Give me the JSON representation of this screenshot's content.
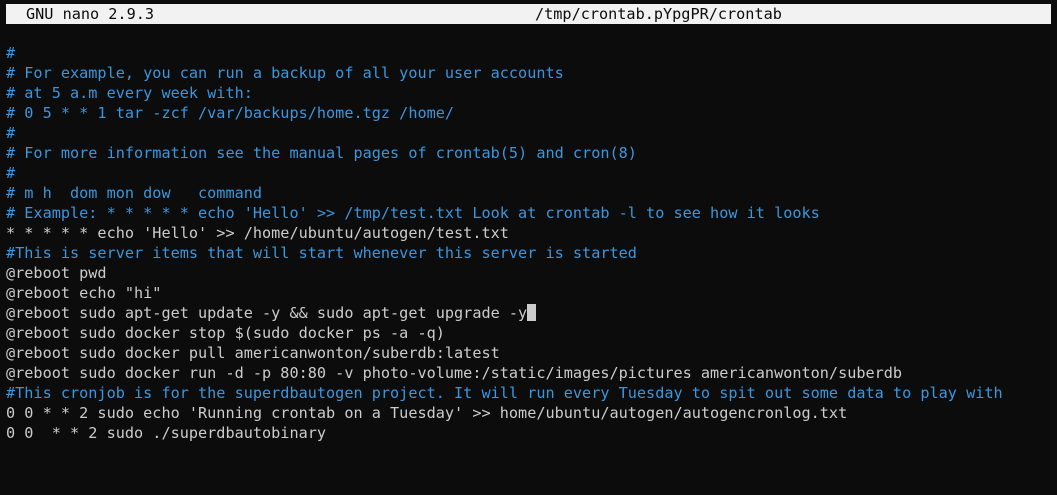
{
  "header": {
    "app": "GNU nano 2.9.3",
    "file": "/tmp/crontab.pYpgPR/crontab"
  },
  "colors": {
    "background": "#0c0c0c",
    "text": "#cccccc",
    "comment": "#3a96dd",
    "titlebar": "#f2f2f2"
  },
  "lines": [
    {
      "text": "#",
      "type": "comment"
    },
    {
      "text": "# For example, you can run a backup of all your user accounts",
      "type": "comment"
    },
    {
      "text": "# at 5 a.m every week with:",
      "type": "comment"
    },
    {
      "text": "# 0 5 * * 1 tar -zcf /var/backups/home.tgz /home/",
      "type": "comment"
    },
    {
      "text": "#",
      "type": "comment"
    },
    {
      "text": "# For more information see the manual pages of crontab(5) and cron(8)",
      "type": "comment"
    },
    {
      "text": "#",
      "type": "comment"
    },
    {
      "text": "# m h  dom mon dow   command",
      "type": "comment"
    },
    {
      "text": "# Example: * * * * * echo 'Hello' >> /tmp/test.txt Look at crontab -l to see how it looks",
      "type": "comment"
    },
    {
      "text": "* * * * * echo 'Hello' >> /home/ubuntu/autogen/test.txt",
      "type": "code"
    },
    {
      "text": "#This is server items that will start whenever this server is started",
      "type": "comment"
    },
    {
      "text": "@reboot pwd",
      "type": "code"
    },
    {
      "text": "@reboot echo \"hi\"",
      "type": "code"
    },
    {
      "text": "@reboot sudo apt-get update -y && sudo apt-get upgrade -y",
      "type": "code"
    },
    {
      "text": "@reboot sudo docker stop $(sudo docker ps -a -q)",
      "type": "code"
    },
    {
      "text": "@reboot sudo docker pull americanwonton/suberdb:latest",
      "type": "code"
    },
    {
      "text": "@reboot sudo docker run -d -p 80:80 -v photo-volume:/static/images/pictures americanwonton/suberdb",
      "type": "code"
    },
    {
      "text": "#This cronjob is for the superdbautogen project. It will run every Tuesday to spit out some data to play with",
      "type": "comment"
    },
    {
      "text": "0 0 * * 2 sudo echo 'Running crontab on a Tuesday' >> home/ubuntu/autogen/autogencronlog.txt",
      "type": "code"
    },
    {
      "text": "0 0  * * 2 sudo ./superdbautobinary",
      "type": "code"
    }
  ]
}
